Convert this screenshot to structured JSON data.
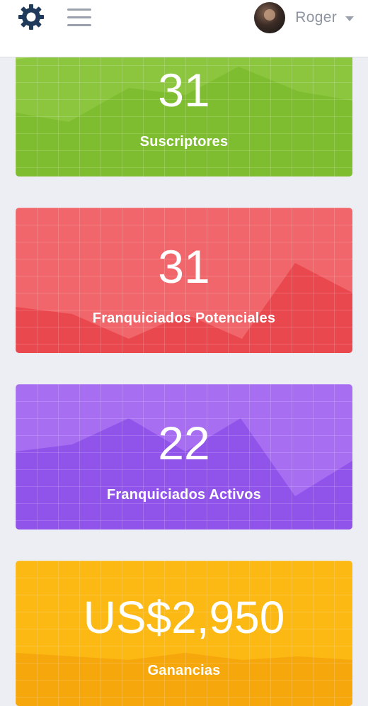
{
  "header": {
    "username": "Roger",
    "icons": [
      "gear-icon",
      "menu-icon",
      "chevron-down-icon"
    ]
  },
  "cards": [
    {
      "value": "31",
      "label": "Suscriptores",
      "color": "#8cc63f"
    },
    {
      "value": "31",
      "label": "Franquiciados Potenciales",
      "color": "#ef5e64"
    },
    {
      "value": "22",
      "label": "Franquiciados Activos",
      "color": "#9b62ee"
    },
    {
      "value": "US$2,950",
      "label": "Ganancias",
      "color": "#fcb813"
    }
  ]
}
